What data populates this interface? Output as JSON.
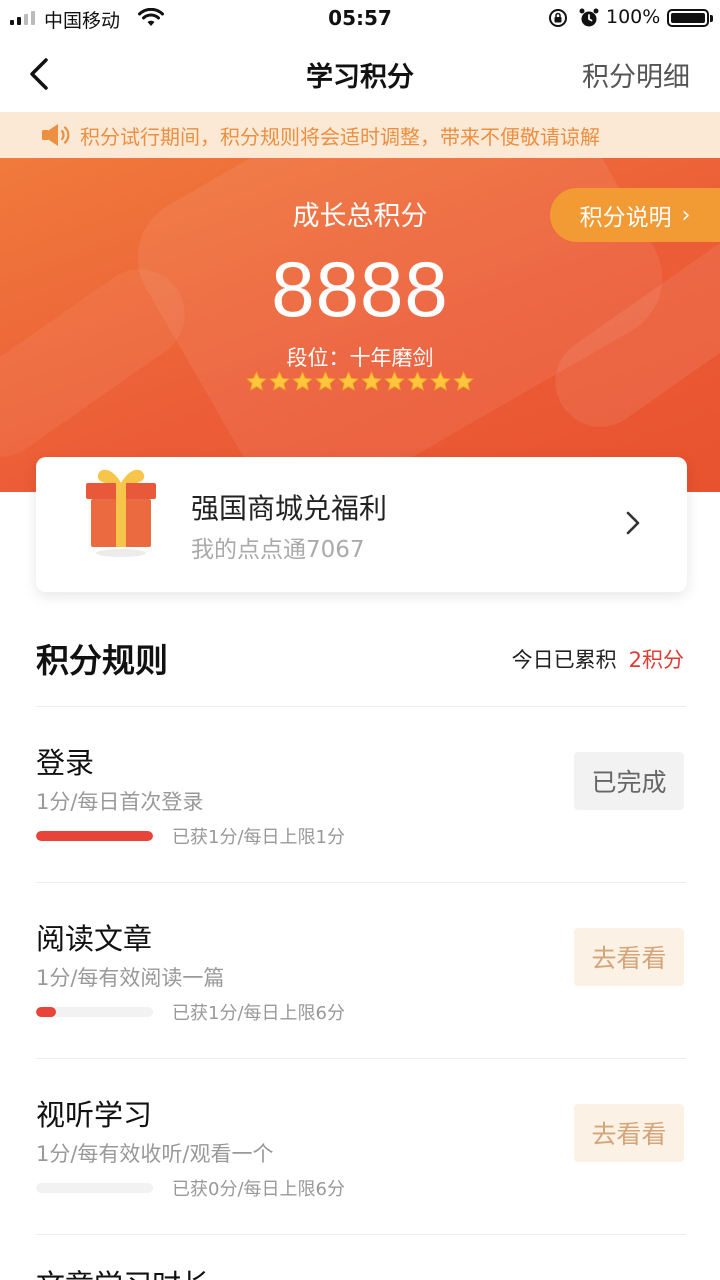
{
  "status_bar": {
    "carrier": "中国移动",
    "time": "05:57",
    "battery": "100%"
  },
  "nav": {
    "title": "学习积分",
    "right_link": "积分明细"
  },
  "notice": {
    "text": "积分试行期间，积分规则将会适时调整，带来不便敬请谅解"
  },
  "hero": {
    "label": "成长总积分",
    "points": "8888",
    "rank": "段位：十年磨剑",
    "stars": 10,
    "explain_button": "积分说明",
    "explain_chevron": "›"
  },
  "mall": {
    "title": "强国商城兑福利",
    "subtitle": "我的点点通7067"
  },
  "rules": {
    "title": "积分规则",
    "today_label": "今日已累积",
    "today_value": "2积分",
    "items": [
      {
        "name": "登录",
        "desc": "1分/每日首次登录",
        "progress_text": "已获1分/每日上限1分",
        "progress": 1.0,
        "action": "已完成",
        "state": "done"
      },
      {
        "name": "阅读文章",
        "desc": "1分/每有效阅读一篇",
        "progress_text": "已获1分/每日上限6分",
        "progress": 0.167,
        "action": "去看看",
        "state": "go"
      },
      {
        "name": "视听学习",
        "desc": "1分/每有效收听/观看一个",
        "progress_text": "已获0分/每日上限6分",
        "progress": 0.0,
        "action": "去看看",
        "state": "go"
      }
    ],
    "partial_next": "文章学习时长"
  },
  "colors": {
    "accent_red": "#e8443a",
    "hero_orange": "#ec5d37",
    "notice_text": "#ec8f40",
    "star": "#ffc53d"
  }
}
